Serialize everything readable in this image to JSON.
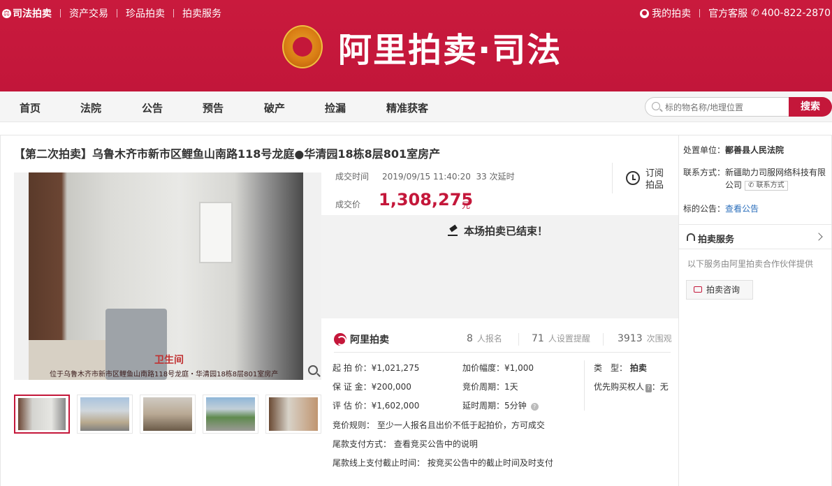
{
  "topbar": {
    "brand": "司法拍卖",
    "links": [
      "资产交易",
      "珍品拍卖",
      "拍卖服务"
    ],
    "my_auction": "我的拍卖",
    "service": "官方客服",
    "phone": "400-822-2870"
  },
  "logo": {
    "text": "阿里拍卖·司法"
  },
  "nav": {
    "items": [
      "首页",
      "法院",
      "公告",
      "预告",
      "破产",
      "捡漏",
      "精准获客"
    ],
    "search_placeholder": "标的物名称/地理位置",
    "search_button": "搜索"
  },
  "item": {
    "title": "【第二次拍卖】乌鲁木齐市新市区鲤鱼山南路118号龙庭●华清园18栋8层801室房产",
    "photo_caption": "位于乌鲁木齐市新市区鲤鱼山南路118号龙庭・华清园18栋8层801室房产",
    "photo_watermark": "卫生间",
    "deal_time_label": "成交时间",
    "deal_time": "2019/09/15 11:40:20",
    "delay": "33 次延时",
    "deal_price_label": "成交价",
    "deal_price": "1,308,275",
    "price_unit": "元",
    "subscribe": "订阅拍品",
    "ended_msg": "本场拍卖已结束！"
  },
  "stats": {
    "brand": "阿里拍卖",
    "signup_count": "8",
    "signup_unit": "人报名",
    "remind_count": "71",
    "remind_unit": "人设置提醒",
    "view_count": "3913",
    "view_unit": "次围观",
    "start_price": "起 拍 价：¥1,021,275",
    "deposit": "保 证 金：¥200,000",
    "eval_price": "评 估 价：¥1,602,000",
    "increment": "加价幅度：¥1,000",
    "cycle": "竞价周期：1天",
    "delay_cycle": "延时周期：5分钟",
    "type_label": "类　型：",
    "type_value": "拍卖",
    "priority_label": "优先购买权人",
    "priority_value": "：无",
    "rule": "竞价规则：  至少一人报名且出价不低于起拍价，方可成交",
    "payment": "尾款支付方式：  查看竞买公告中的说明",
    "deadline": "尾款线上支付截止时间：  按竞买公告中的截止时间及时支付"
  },
  "side": {
    "unit_label": "处置单位：",
    "unit_value": "鄯善县人民法院",
    "contact_label": "联系方式：",
    "contact_value_1": "新疆助力司服网络科技有限",
    "contact_value_2": "公司",
    "contact_btn": "联系方式",
    "notice_label": "标的公告：",
    "notice_link": "查看公告",
    "service_title": "拍卖服务",
    "service_note": "以下服务由阿里拍卖合作伙伴提供",
    "consult": "拍卖咨询"
  },
  "colors": {
    "brand_red": "#c4173a",
    "link_blue": "#2a6ebb"
  }
}
